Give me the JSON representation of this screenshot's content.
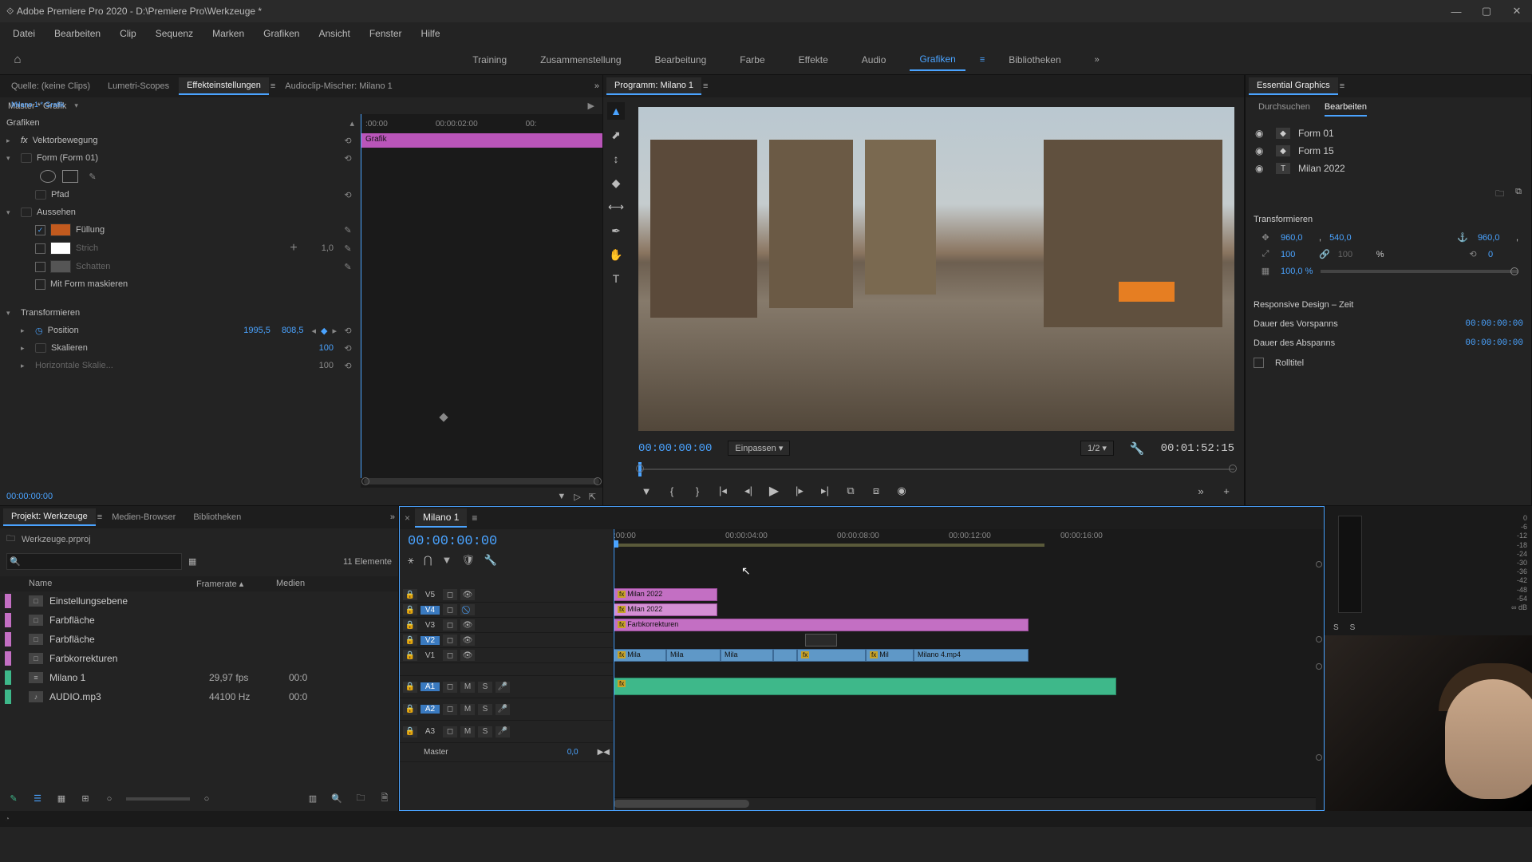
{
  "title": "Adobe Premiere Pro 2020 - D:\\Premiere Pro\\Werkzeuge *",
  "menu": [
    "Datei",
    "Bearbeiten",
    "Clip",
    "Sequenz",
    "Marken",
    "Grafiken",
    "Ansicht",
    "Fenster",
    "Hilfe"
  ],
  "workspaces": {
    "items": [
      "Training",
      "Zusammenstellung",
      "Bearbeitung",
      "Farbe",
      "Effekte",
      "Audio",
      "Grafiken",
      "Bibliotheken"
    ],
    "active": "Grafiken"
  },
  "sourceTabs": {
    "source": "Quelle: (keine Clips)",
    "lumetri": "Lumetri-Scopes",
    "effects": "Effekteinstellungen",
    "mixer": "Audioclip-Mischer: Milano 1"
  },
  "effectHeader": {
    "master": "Master * Grafik",
    "clip": "Milano 1 * Grafik"
  },
  "effectTimeline": {
    "t0": ":00:00",
    "t1": "00:00:02:00",
    "t2": "00:",
    "clip": "Grafik"
  },
  "effectTree": {
    "graphics": "Grafiken",
    "vectorMotion": "Vektorbewegung",
    "form": "Form (Form 01)",
    "path": "Pfad",
    "appearance": "Aussehen",
    "fill": "Füllung",
    "stroke": "Strich",
    "strokeVal": "1,0",
    "shadow": "Schatten",
    "mask": "Mit Form maskieren",
    "transform": "Transformieren",
    "position": "Position",
    "posX": "1995,5",
    "posY": "808,5",
    "scale": "Skalieren",
    "scaleVal": "100",
    "hscale": "Horizontale Skalie...",
    "hscaleVal": "100"
  },
  "effectFoot": "00:00:00:00",
  "program": {
    "title": "Programm: Milano 1",
    "tcLeft": "00:00:00:00",
    "fit": "Einpassen",
    "res": "1/2",
    "tcRight": "00:01:52:15"
  },
  "eg": {
    "title": "Essential Graphics",
    "browse": "Durchsuchen",
    "edit": "Bearbeiten",
    "layers": [
      {
        "type": "shape",
        "name": "Form 01"
      },
      {
        "type": "shape",
        "name": "Form 15"
      },
      {
        "type": "text",
        "name": "Milan 2022"
      }
    ],
    "transformTitle": "Transformieren",
    "posX": "960,0",
    "posY": "540,0",
    "anchor": "960,0",
    "scale": "100",
    "scaleH": "100",
    "pct": "%",
    "rotation": "0",
    "opacity": "100,0 %",
    "responsive": "Responsive Design – Zeit",
    "intro": "Dauer des Vorspanns",
    "introVal": "00:00:00:00",
    "outro": "Dauer des Abspanns",
    "outroVal": "00:00:00:00",
    "roll": "Rolltitel"
  },
  "projectTabs": {
    "project": "Projekt: Werkzeuge",
    "media": "Medien-Browser",
    "lib": "Bibliotheken"
  },
  "project": {
    "file": "Werkzeuge.prproj",
    "count": "11 Elemente",
    "cols": {
      "name": "Name",
      "fps": "Framerate",
      "media": "Medien"
    },
    "items": [
      {
        "c": "#c36fc3",
        "icon": "□",
        "name": "Einstellungsebene",
        "fps": "",
        "media": ""
      },
      {
        "c": "#c36fc3",
        "icon": "□",
        "name": "Farbfläche",
        "fps": "",
        "media": ""
      },
      {
        "c": "#c36fc3",
        "icon": "□",
        "name": "Farbfläche",
        "fps": "",
        "media": ""
      },
      {
        "c": "#c36fc3",
        "icon": "□",
        "name": "Farbkorrekturen",
        "fps": "",
        "media": ""
      },
      {
        "c": "#3eb88a",
        "icon": "≡",
        "name": "Milano 1",
        "fps": "29,97 fps",
        "media": "00:0"
      },
      {
        "c": "#3eb88a",
        "icon": "♪",
        "name": "AUDIO.mp3",
        "fps": "44100 Hz",
        "media": "00:0"
      }
    ]
  },
  "timeline": {
    "seq": "Milano 1",
    "tc": "00:00:00:00",
    "ruler": [
      ":00:00",
      "00:00:04:00",
      "00:00:08:00",
      "00:00:12:00",
      "00:00:16:00"
    ],
    "tracks": {
      "v": [
        "V5",
        "V4",
        "V3",
        "V2",
        "V1"
      ],
      "a": [
        "A1",
        "A2",
        "A3"
      ],
      "master": "Master",
      "masterVal": "0,0",
      "mbtn": "M",
      "sbtn": "S"
    },
    "clips": {
      "v5": "Milan 2022",
      "v4": "Milan 2022",
      "v3": "Farbkorrekturen",
      "v1": [
        "Mila",
        "Mila",
        "Mila",
        "",
        "",
        "Mil",
        "Milano 4.mp4"
      ]
    }
  },
  "meter": {
    "scale": [
      "0",
      "-6",
      "-12",
      "-18",
      "-24",
      "-30",
      "-36",
      "-42",
      "-48",
      "-54",
      "∞ dB"
    ],
    "s": "S"
  }
}
